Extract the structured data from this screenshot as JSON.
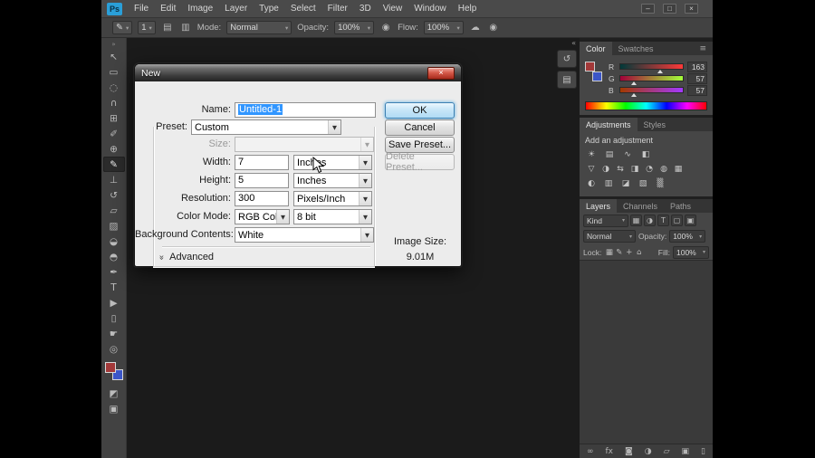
{
  "menubar": {
    "logo": "Ps",
    "items": [
      "File",
      "Edit",
      "Image",
      "Layer",
      "Type",
      "Select",
      "Filter",
      "3D",
      "View",
      "Window",
      "Help"
    ]
  },
  "window_controls": {
    "minimize": "–",
    "maximize": "□",
    "close": "×"
  },
  "options": {
    "preset_icon": "✎",
    "brush_size": "1",
    "panel_icon_a": "▤",
    "panel_icon_b": "▥",
    "mode_label": "Mode:",
    "mode_value": "Normal",
    "opacity_label": "Opacity:",
    "opacity_value": "100%",
    "pressure_icon": "◉",
    "flow_label": "Flow:",
    "flow_value": "100%",
    "airbrush_icon": "☁",
    "pressure_size_icon": "◉"
  },
  "toolbar": {
    "collapse_glyph": "»",
    "tools": [
      {
        "name": "move-tool",
        "glyph": "↖"
      },
      {
        "name": "rectangular-marquee-tool",
        "glyph": "▭"
      },
      {
        "name": "lasso-tool",
        "glyph": "◌"
      },
      {
        "name": "quick-selection-tool",
        "glyph": "∩"
      },
      {
        "name": "crop-tool",
        "glyph": "⊞"
      },
      {
        "name": "eyedropper-tool",
        "glyph": "✐"
      },
      {
        "name": "spot-healing-brush-tool",
        "glyph": "⊕"
      },
      {
        "name": "brush-tool",
        "glyph": "✎",
        "selected": true
      },
      {
        "name": "clone-stamp-tool",
        "glyph": "⊥"
      },
      {
        "name": "history-brush-tool",
        "glyph": "↺"
      },
      {
        "name": "eraser-tool",
        "glyph": "▱"
      },
      {
        "name": "gradient-tool",
        "glyph": "▨"
      },
      {
        "name": "blur-tool",
        "glyph": "◒"
      },
      {
        "name": "dodge-tool",
        "glyph": "◓"
      },
      {
        "name": "pen-tool",
        "glyph": "✒"
      },
      {
        "name": "type-tool",
        "glyph": "T"
      },
      {
        "name": "path-selection-tool",
        "glyph": "▶"
      },
      {
        "name": "rectangle-tool",
        "glyph": "▯"
      },
      {
        "name": "hand-tool",
        "glyph": "☛"
      },
      {
        "name": "zoom-tool",
        "glyph": "◎"
      }
    ],
    "quick_mask_glyph": "◩",
    "screen_mode_glyph": "▣"
  },
  "colors": {
    "foreground": "#a33939",
    "background": "#3b56c8"
  },
  "dock_strip": {
    "collapse_glyph": "«",
    "icons": [
      {
        "name": "history-panel-icon",
        "glyph": "↺"
      },
      {
        "name": "mini-bridge-panel-icon",
        "glyph": "▤"
      }
    ]
  },
  "panels": {
    "color": {
      "tabs": [
        {
          "label": "Color",
          "active": true
        },
        {
          "label": "Swatches"
        }
      ],
      "menu_icon": "≡",
      "channels": [
        {
          "label": "R",
          "value": "163"
        },
        {
          "label": "G",
          "value": "57"
        },
        {
          "label": "B",
          "value": "57"
        }
      ]
    },
    "adjustments": {
      "tabs": [
        {
          "label": "Adjustments",
          "active": true
        },
        {
          "label": "Styles"
        }
      ],
      "menu_icon": "≡",
      "heading": "Add an adjustment",
      "row1": [
        {
          "name": "brightness-contrast-icon",
          "glyph": "☀"
        },
        {
          "name": "levels-icon",
          "glyph": "▤"
        },
        {
          "name": "curves-icon",
          "glyph": "∿"
        },
        {
          "name": "exposure-icon",
          "glyph": "◧"
        }
      ],
      "row2": [
        {
          "name": "vibrance-icon",
          "glyph": "▽"
        },
        {
          "name": "hue-saturation-icon",
          "glyph": "◑"
        },
        {
          "name": "color-balance-icon",
          "glyph": "⇆"
        },
        {
          "name": "black-white-icon",
          "glyph": "◨"
        },
        {
          "name": "photo-filter-icon",
          "glyph": "◔"
        },
        {
          "name": "channel-mixer-icon",
          "glyph": "◍"
        },
        {
          "name": "color-lookup-icon",
          "glyph": "▦"
        }
      ],
      "row3": [
        {
          "name": "invert-icon",
          "glyph": "◐"
        },
        {
          "name": "posterize-icon",
          "glyph": "▥"
        },
        {
          "name": "threshold-icon",
          "glyph": "◪"
        },
        {
          "name": "gradient-map-icon",
          "glyph": "▧"
        },
        {
          "name": "selective-color-icon",
          "glyph": "▒"
        }
      ]
    },
    "layers": {
      "tabs": [
        {
          "label": "Layers",
          "active": true
        },
        {
          "label": "Channels"
        },
        {
          "label": "Paths"
        }
      ],
      "menu_icon": "≡",
      "kind_value": "Kind",
      "filter_icons": [
        {
          "name": "pixel-layer-filter-icon",
          "glyph": "▦"
        },
        {
          "name": "adjustment-layer-filter-icon",
          "glyph": "◑"
        },
        {
          "name": "type-layer-filter-icon",
          "glyph": "T"
        },
        {
          "name": "shape-layer-filter-icon",
          "glyph": "▢"
        },
        {
          "name": "smart-object-filter-icon",
          "glyph": "▣"
        }
      ],
      "blend_value": "Normal",
      "opacity_label": "Opacity:",
      "opacity_value": "100%",
      "lock_label": "Lock:",
      "lock_icons": [
        {
          "name": "lock-transparency-icon",
          "glyph": "▦"
        },
        {
          "name": "lock-pixels-icon",
          "glyph": "✎"
        },
        {
          "name": "lock-position-icon",
          "glyph": "+"
        },
        {
          "name": "lock-all-icon",
          "glyph": "⌂"
        }
      ],
      "fill_label": "Fill:",
      "fill_value": "100%",
      "bottom_icons": [
        {
          "name": "link-layers-icon",
          "glyph": "∞"
        },
        {
          "name": "layer-effects-icon",
          "glyph": "fx"
        },
        {
          "name": "layer-mask-icon",
          "glyph": "◙"
        },
        {
          "name": "adjustment-layer-icon",
          "glyph": "◑"
        },
        {
          "name": "layer-group-icon",
          "glyph": "▱"
        },
        {
          "name": "new-layer-icon",
          "glyph": "▣"
        },
        {
          "name": "delete-layer-icon",
          "glyph": "▯"
        }
      ]
    }
  },
  "dialog": {
    "title": "New",
    "close_glyph": "×",
    "name_label": "Name:",
    "name_value": "Untitled-1",
    "preset_label": "Preset:",
    "preset_value": "Custom",
    "size_label": "Size:",
    "size_value": "",
    "width_label": "Width:",
    "width_value": "7",
    "width_unit": "Inches",
    "height_label": "Height:",
    "height_value": "5",
    "height_unit": "Inches",
    "resolution_label": "Resolution:",
    "resolution_value": "300",
    "resolution_unit": "Pixels/Inch",
    "color_mode_label": "Color Mode:",
    "color_mode_value": "RGB Color",
    "bit_depth_value": "8 bit",
    "background_label": "Background Contents:",
    "background_value": "White",
    "advanced_label": "Advanced",
    "advanced_chevrons": "»",
    "ok_label": "OK",
    "cancel_label": "Cancel",
    "save_preset_label": "Save Preset...",
    "delete_preset_label": "Delete Preset...",
    "image_size_label": "Image Size:",
    "image_size_value": "9.01M"
  }
}
